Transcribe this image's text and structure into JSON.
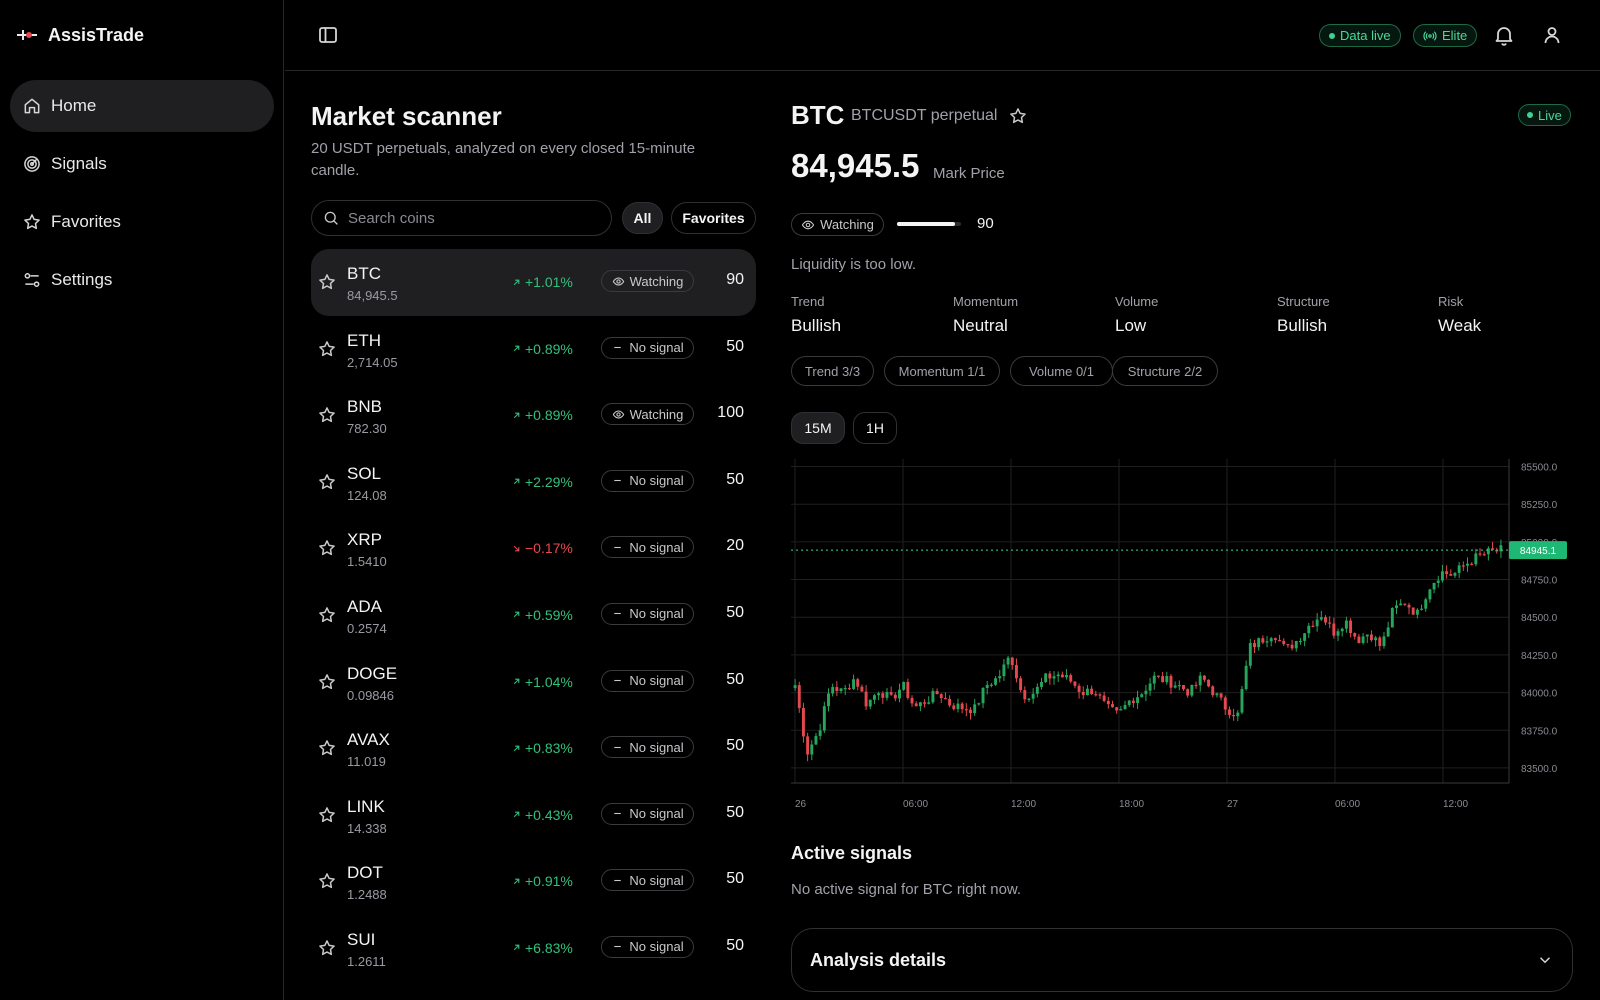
{
  "app": {
    "name": "AssisTrade"
  },
  "sidebar": {
    "items": [
      {
        "label": "Home",
        "icon": "home-icon",
        "active": true
      },
      {
        "label": "Signals",
        "icon": "radar-icon",
        "active": false
      },
      {
        "label": "Favorites",
        "icon": "star-icon",
        "active": false
      },
      {
        "label": "Settings",
        "icon": "sliders-icon",
        "active": false
      }
    ]
  },
  "topbar": {
    "data_live": "Data live",
    "plan": "Elite"
  },
  "scanner": {
    "title": "Market scanner",
    "subtitle": "20 USDT perpetuals, analyzed on every closed 15-minute candle.",
    "search_placeholder": "Search coins",
    "filters": [
      "All",
      "Favorites"
    ],
    "active_filter": "All",
    "coins": [
      {
        "symbol": "BTC",
        "price": "84,945.5",
        "change": "+1.01%",
        "direction": "up",
        "signal": "Watching",
        "score": "90",
        "selected": true
      },
      {
        "symbol": "ETH",
        "price": "2,714.05",
        "change": "+0.89%",
        "direction": "up",
        "signal": "No signal",
        "score": "50"
      },
      {
        "symbol": "BNB",
        "price": "782.30",
        "change": "+0.89%",
        "direction": "up",
        "signal": "Watching",
        "score": "100"
      },
      {
        "symbol": "SOL",
        "price": "124.08",
        "change": "+2.29%",
        "direction": "up",
        "signal": "No signal",
        "score": "50"
      },
      {
        "symbol": "XRP",
        "price": "1.5410",
        "change": "−0.17%",
        "direction": "down",
        "signal": "No signal",
        "score": "20"
      },
      {
        "symbol": "ADA",
        "price": "0.2574",
        "change": "+0.59%",
        "direction": "up",
        "signal": "No signal",
        "score": "50"
      },
      {
        "symbol": "DOGE",
        "price": "0.09846",
        "change": "+1.04%",
        "direction": "up",
        "signal": "No signal",
        "score": "50"
      },
      {
        "symbol": "AVAX",
        "price": "11.019",
        "change": "+0.83%",
        "direction": "up",
        "signal": "No signal",
        "score": "50"
      },
      {
        "symbol": "LINK",
        "price": "14.338",
        "change": "+0.43%",
        "direction": "up",
        "signal": "No signal",
        "score": "50"
      },
      {
        "symbol": "DOT",
        "price": "1.2488",
        "change": "+0.91%",
        "direction": "up",
        "signal": "No signal",
        "score": "50"
      },
      {
        "symbol": "SUI",
        "price": "1.2611",
        "change": "+6.83%",
        "direction": "up",
        "signal": "No signal",
        "score": "50"
      }
    ]
  },
  "detail": {
    "symbol": "BTC",
    "pair": "BTCUSDT perpetual",
    "live": "Live",
    "price": "84,945.5",
    "price_label": "Mark Price",
    "status": "Watching",
    "score": "90",
    "score_fraction": 0.9,
    "message": "Liquidity is too low.",
    "metrics": [
      {
        "label": "Trend",
        "value": "Bullish"
      },
      {
        "label": "Momentum",
        "value": "Neutral"
      },
      {
        "label": "Volume",
        "value": "Low"
      },
      {
        "label": "Structure",
        "value": "Bullish"
      },
      {
        "label": "Risk",
        "value": "Weak"
      }
    ],
    "factors": [
      "Trend 3/3",
      "Momentum 1/1",
      "Volume 0/1",
      "Structure 2/2"
    ],
    "timeframes": [
      "15M",
      "1H"
    ],
    "active_timeframe": "15M",
    "active_signals_title": "Active signals",
    "active_signals_text": "No active signal for BTC right now.",
    "analysis_title": "Analysis details"
  },
  "colors": {
    "up": "#26a65b",
    "down": "#e5484d",
    "accent": "#3ed394"
  },
  "chart_data": {
    "type": "candlestick",
    "y_ticks": [
      "85500.0",
      "85250.0",
      "85000.0",
      "84750.0",
      "84500.0",
      "84250.0",
      "84000.0",
      "83750.0",
      "83500.0"
    ],
    "ylim": [
      83400,
      85550
    ],
    "x_ticks": [
      "26",
      "06:00",
      "12:00",
      "18:00",
      "27",
      "06:00",
      "12:00"
    ],
    "last_price_label": "84945.1",
    "last_price": 84945.1,
    "close_path": [
      84050,
      83600,
      83750,
      84050,
      84000,
      84100,
      83920,
      84020,
      83950,
      84050,
      83900,
      83950,
      84000,
      83920,
      83900,
      83890,
      84050,
      84100,
      84250,
      83980,
      84000,
      84100,
      84120,
      84080,
      84000,
      84020,
      83900,
      83850,
      83950,
      84000,
      84100,
      84080,
      84050,
      84000,
      84100,
      84000,
      83900,
      83850,
      84300,
      84350,
      84400,
      84280,
      84350,
      84450,
      84520,
      84400,
      84480,
      84350,
      84400,
      84300,
      84550,
      84600,
      84520,
      84700,
      84800,
      84780,
      84850,
      84900,
      84930,
      84945
    ]
  }
}
